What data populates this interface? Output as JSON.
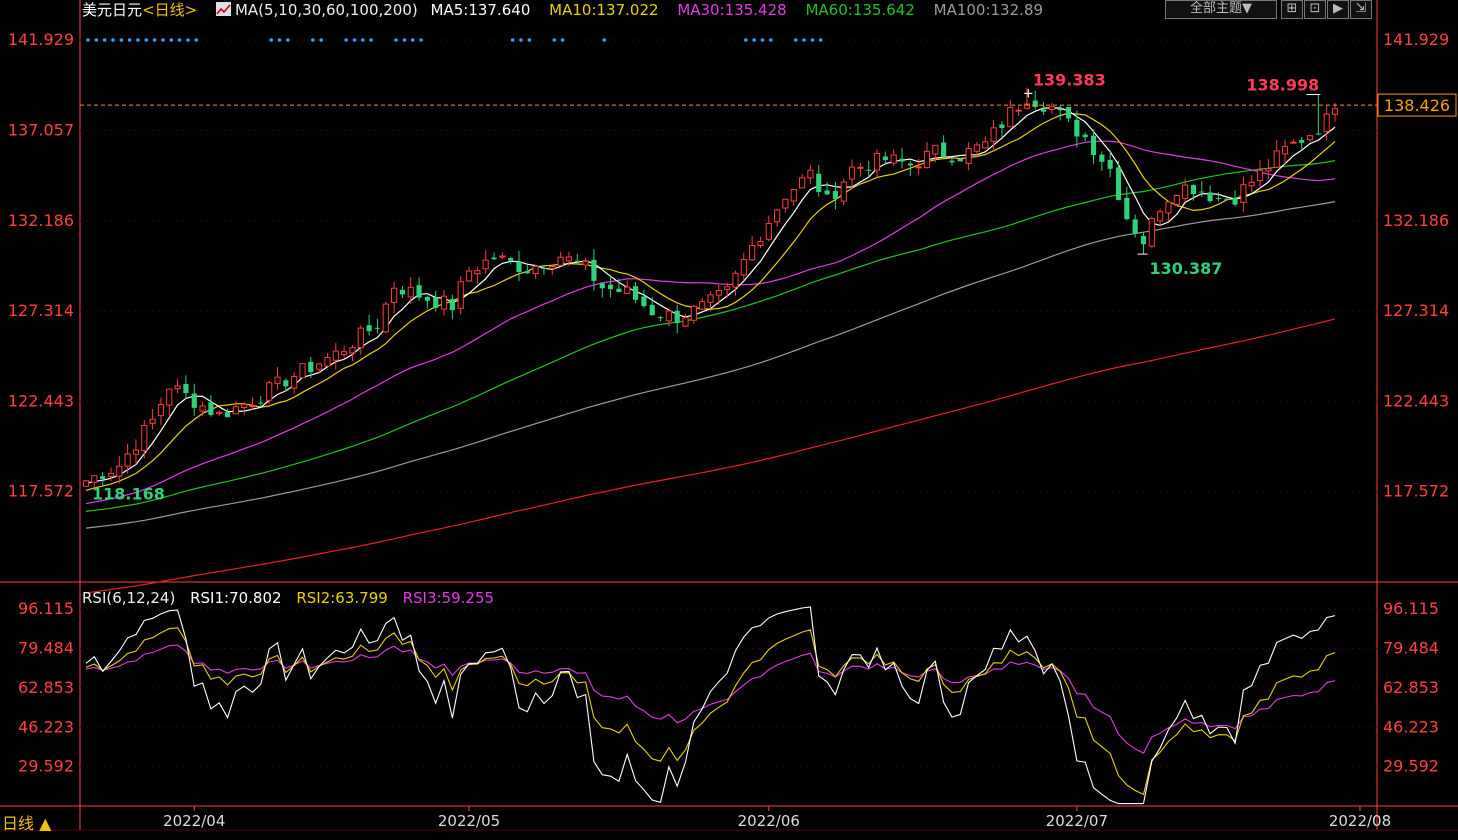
{
  "header": {
    "symbol": "美元日元",
    "period": "<日线>",
    "ma_params": "MA(5,10,30,60,100,200)",
    "ma5": "MA5:137.640",
    "ma10": "MA10:137.022",
    "ma30": "MA30:135.428",
    "ma60": "MA60:135.642",
    "ma100": "MA100:132.89",
    "theme_button": "全部主题▼"
  },
  "colors": {
    "up": "#ff3b3b",
    "down": "#2fd17a",
    "ma5": "#ffffff",
    "ma10": "#e8d200",
    "ma30": "#e23ce2",
    "ma60": "#1fc41f",
    "ma100": "#9a9a9a",
    "ma200": "#e82020",
    "axis": "#ff4040",
    "grid": "#3a0000"
  },
  "price_axis": {
    "ticks": [
      "141.929",
      "137.057",
      "132.186",
      "127.314",
      "122.443",
      "117.572"
    ],
    "current": "138.426"
  },
  "annotations": {
    "high1": "139.383",
    "high2": "138.998",
    "low1": "130.387",
    "start_low": "118.168"
  },
  "rsi": {
    "title": "RSI(6,12,24)",
    "rsi1": "RSI1:70.802",
    "rsi2": "RSI2:63.799",
    "rsi3": "RSI3:59.255",
    "ticks": [
      "96.115",
      "79.484",
      "62.853",
      "46.223",
      "29.592"
    ]
  },
  "x_axis": {
    "labels": [
      "2022/04",
      "2022/05",
      "2022/06",
      "2022/07",
      "2022/08"
    ]
  },
  "footer": {
    "period_label": "日线 ▲"
  },
  "chart_data": [
    {
      "type": "candlestick",
      "title": "美元日元 日线",
      "ylim": [
        112.7,
        142.8
      ],
      "x_labels": [
        "2022/04",
        "2022/05",
        "2022/06",
        "2022/07",
        "2022/08"
      ],
      "ohlc_pivots": [
        [
          0,
          118.17
        ],
        [
          4,
          119.0
        ],
        [
          8,
          121.4
        ],
        [
          10,
          123.3
        ],
        [
          14,
          122.2
        ],
        [
          16,
          121.7
        ],
        [
          20,
          122.5
        ],
        [
          24,
          123.6
        ],
        [
          30,
          125.0
        ],
        [
          35,
          126.6
        ],
        [
          37,
          128.7
        ],
        [
          41,
          128.0
        ],
        [
          44,
          127.6
        ],
        [
          46,
          129.5
        ],
        [
          49,
          130.2
        ],
        [
          53,
          129.6
        ],
        [
          57,
          130.3
        ],
        [
          60,
          129.6
        ],
        [
          62,
          128.6
        ],
        [
          65,
          128.3
        ],
        [
          68,
          127.3
        ],
        [
          71,
          127.0
        ],
        [
          74,
          127.5
        ],
        [
          77,
          128.3
        ],
        [
          80,
          130.8
        ],
        [
          84,
          133.6
        ],
        [
          87,
          134.7
        ],
        [
          89,
          133.2
        ],
        [
          92,
          135.0
        ],
        [
          96,
          135.5
        ],
        [
          99,
          135.2
        ],
        [
          102,
          135.9
        ],
        [
          105,
          135.7
        ],
        [
          108,
          136.3
        ],
        [
          111,
          138.0
        ],
        [
          113,
          138.9
        ],
        [
          116,
          138.3
        ],
        [
          118,
          137.4
        ],
        [
          120,
          136.7
        ],
        [
          123,
          135.0
        ],
        [
          125,
          132.4
        ],
        [
          127,
          131.1
        ],
        [
          129,
          133.0
        ],
        [
          131,
          134.0
        ],
        [
          133,
          134.0
        ],
        [
          136,
          133.4
        ],
        [
          138,
          133.5
        ],
        [
          141,
          134.7
        ],
        [
          144,
          136.0
        ],
        [
          147,
          136.9
        ],
        [
          149,
          137.6
        ],
        [
          150,
          138.6
        ]
      ],
      "ma_values": {
        "ma5": "137.640",
        "ma10": "137.022",
        "ma30": "135.428",
        "ma60": "135.642",
        "ma100": "132.89"
      }
    },
    {
      "type": "line",
      "title": "RSI(6,12,24)",
      "ylim": [
        13.0,
        105.0
      ],
      "series": [
        {
          "name": "RSI1",
          "last": 70.802
        },
        {
          "name": "RSI2",
          "last": 63.799
        },
        {
          "name": "RSI3",
          "last": 59.255
        }
      ]
    }
  ]
}
